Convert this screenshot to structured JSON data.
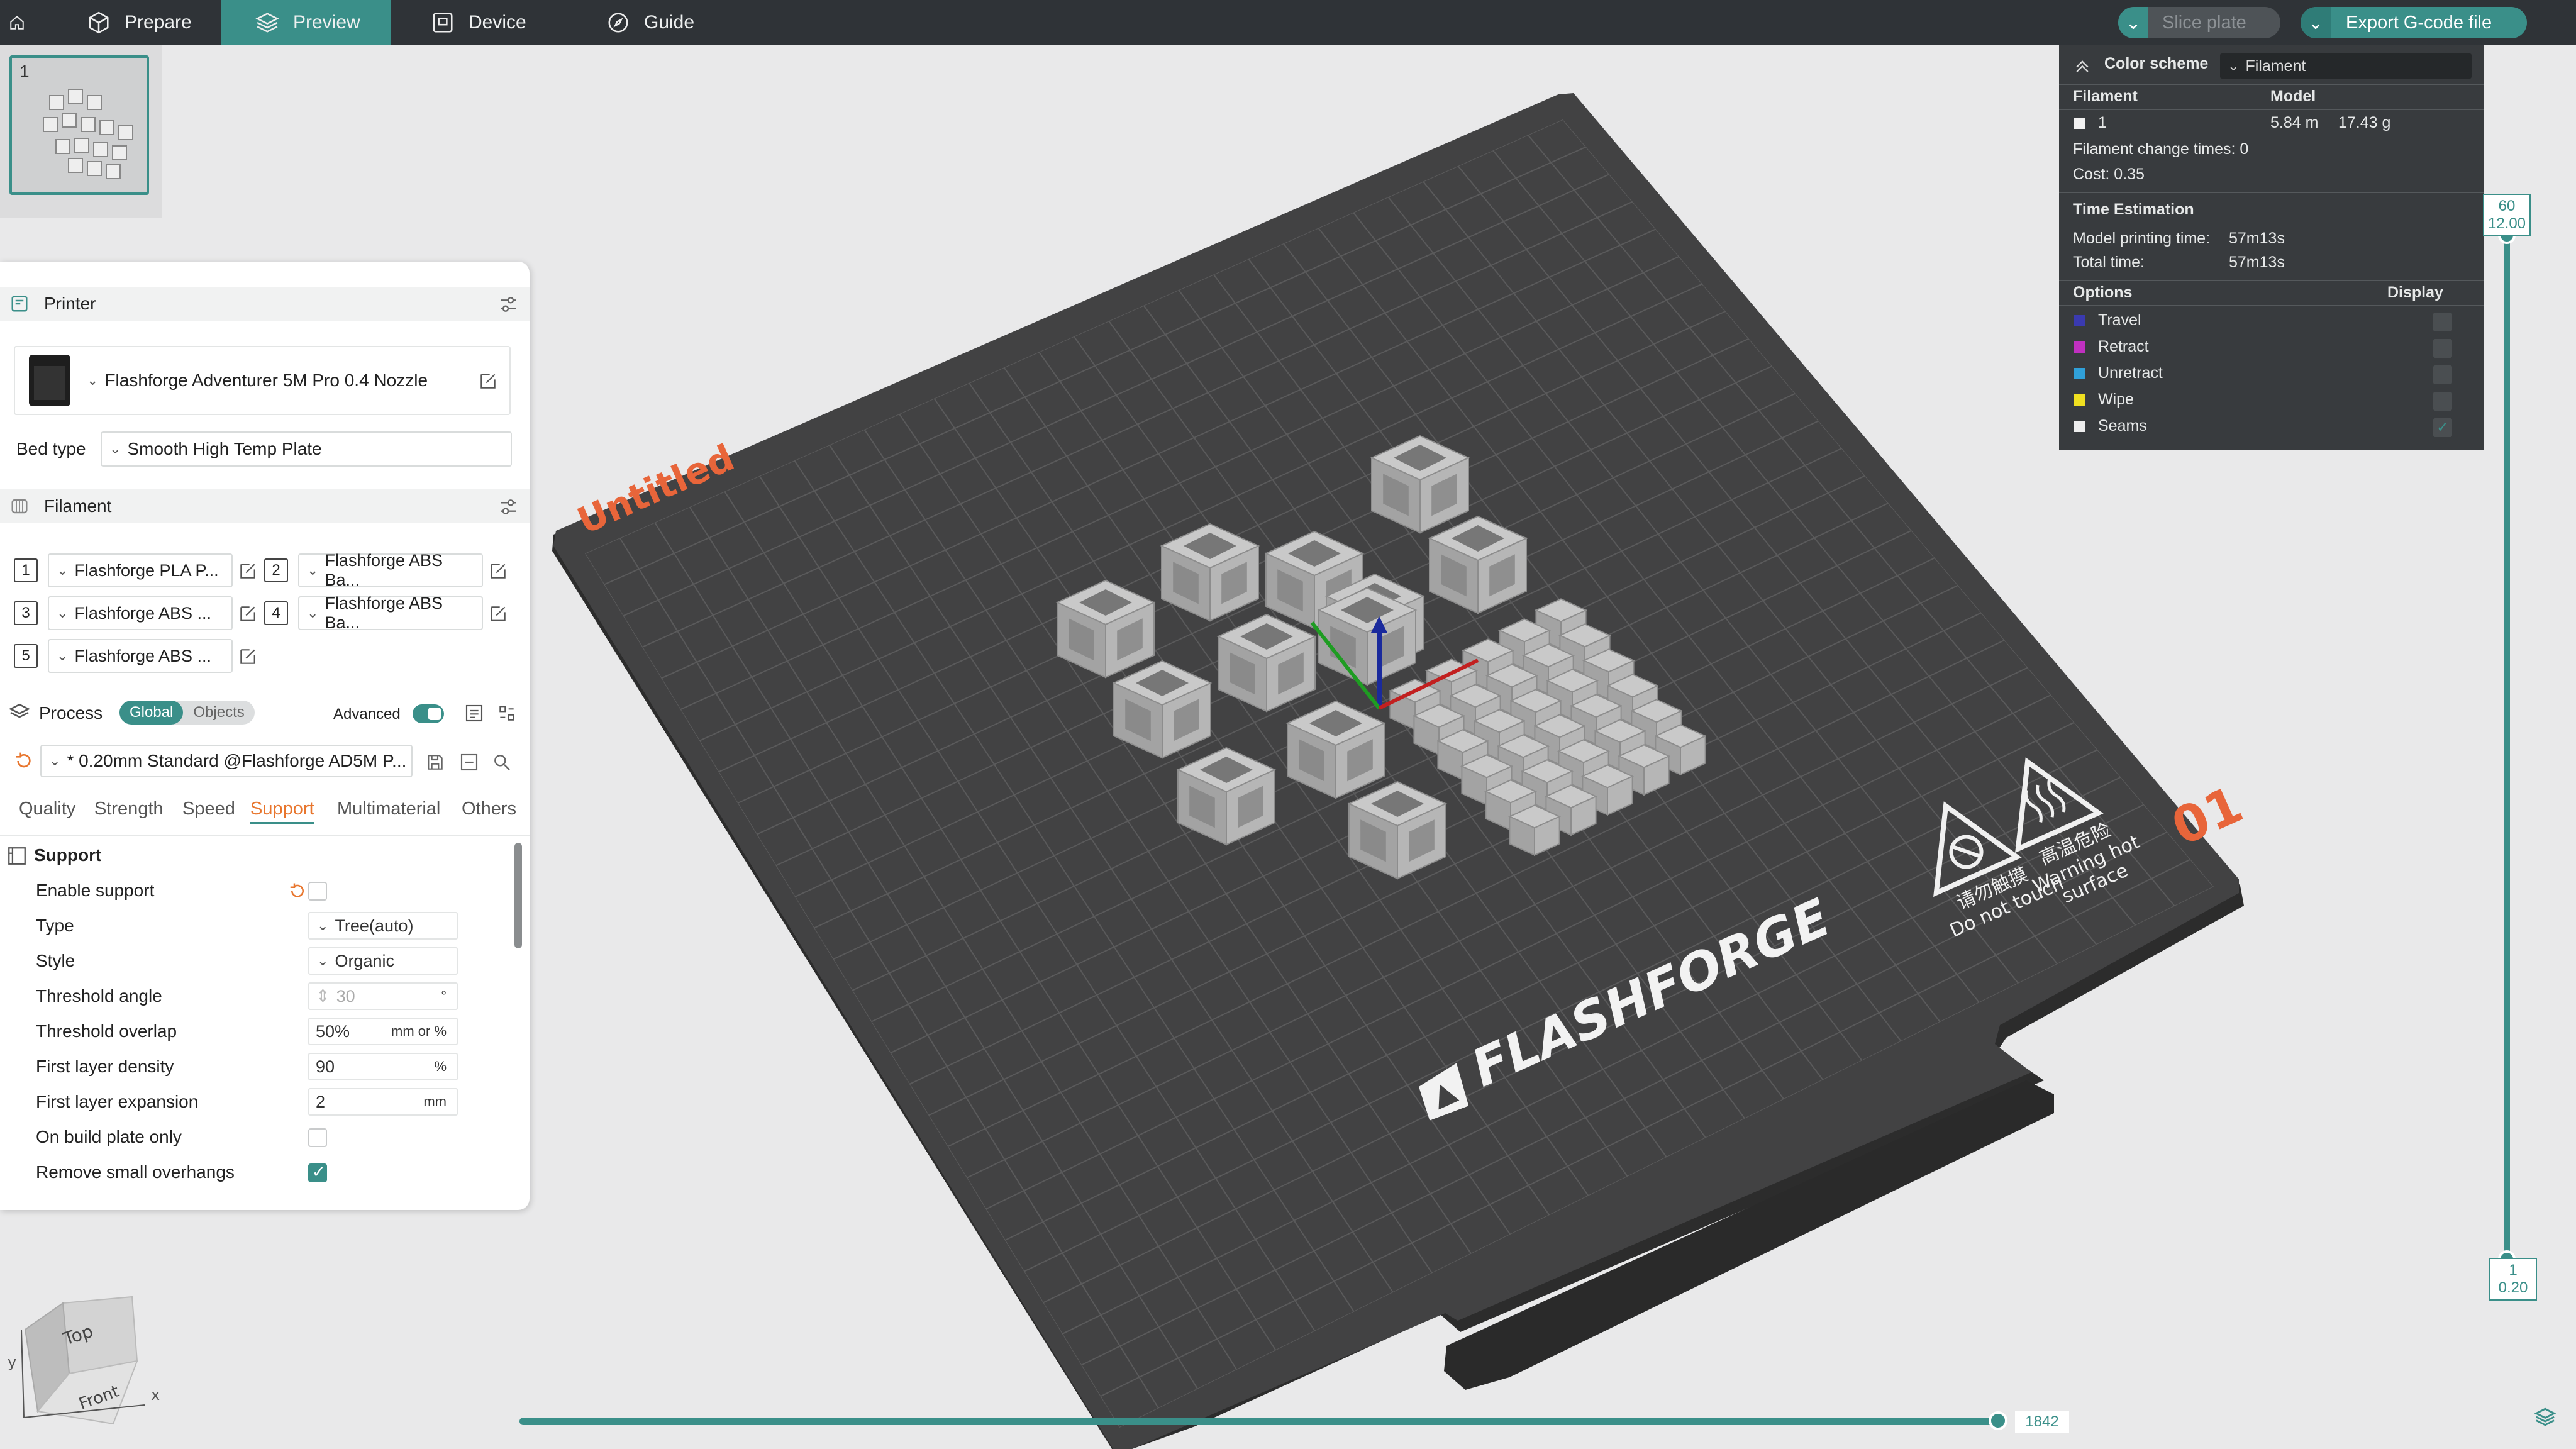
{
  "topbar": {
    "tabs": [
      "Prepare",
      "Preview",
      "Device",
      "Guide"
    ],
    "slice_label": "Slice plate",
    "export_label": "Export G-code file"
  },
  "plate": {
    "number": "1"
  },
  "printer": {
    "section_title": "Printer",
    "name": "Flashforge Adventurer 5M Pro 0.4 Nozzle",
    "bed_label": "Bed type",
    "bed_value": "Smooth High Temp Plate"
  },
  "filament": {
    "section_title": "Filament",
    "items": [
      {
        "idx": "1",
        "name": "Flashforge PLA P..."
      },
      {
        "idx": "2",
        "name": "Flashforge ABS Ba..."
      },
      {
        "idx": "3",
        "name": "Flashforge ABS ..."
      },
      {
        "idx": "4",
        "name": "Flashforge ABS Ba..."
      },
      {
        "idx": "5",
        "name": "Flashforge ABS ..."
      }
    ]
  },
  "process": {
    "section_title": "Process",
    "seg_global": "Global",
    "seg_objects": "Objects",
    "advanced_label": "Advanced",
    "preset": "* 0.20mm Standard @Flashforge AD5M P...",
    "subtabs": [
      "Quality",
      "Strength",
      "Speed",
      "Support",
      "Multimaterial",
      "Others"
    ],
    "group_title": "Support",
    "options": [
      {
        "label": "Enable support",
        "kind": "checkbox",
        "checked": false
      },
      {
        "label": "Type",
        "kind": "select",
        "value": "Tree(auto)"
      },
      {
        "label": "Style",
        "kind": "select",
        "value": "Organic"
      },
      {
        "label": "Threshold angle",
        "kind": "spin",
        "value": "30",
        "unit": "°"
      },
      {
        "label": "Threshold overlap",
        "kind": "text",
        "value": "50%",
        "unit": "mm or %"
      },
      {
        "label": "First layer density",
        "kind": "text",
        "value": "90",
        "unit": "%"
      },
      {
        "label": "First layer expansion",
        "kind": "text",
        "value": "2",
        "unit": "mm"
      },
      {
        "label": "On build plate only",
        "kind": "checkbox",
        "checked": false
      },
      {
        "label": "Remove small overhangs",
        "kind": "checkbox",
        "checked": true
      }
    ]
  },
  "legend": {
    "color_scheme_label": "Color scheme",
    "color_scheme_value": "Filament",
    "col_filament": "Filament",
    "col_model": "Model",
    "filament_idx": "1",
    "filament_length": "5.84 m",
    "filament_weight": "17.43 g",
    "change_times": "Filament change times:  0",
    "cost": "Cost:  0.35",
    "time_title": "Time Estimation",
    "model_time_label": "Model printing time:",
    "model_time": "57m13s",
    "total_time_label": "Total time:",
    "total_time": "57m13s",
    "options_label": "Options",
    "display_label": "Display",
    "options": [
      {
        "name": "Travel",
        "color": "#3a3ab0",
        "checked": false
      },
      {
        "name": "Retract",
        "color": "#c030c0",
        "checked": false
      },
      {
        "name": "Unretract",
        "color": "#30a0d8",
        "checked": false
      },
      {
        "name": "Wipe",
        "color": "#f0e020",
        "checked": false
      },
      {
        "name": "Seams",
        "color": "#eeeeee",
        "checked": true
      }
    ]
  },
  "layers": {
    "top_layer": "60",
    "top_height": "12.00",
    "bottom_layer": "1",
    "bottom_height": "0.20"
  },
  "moves": {
    "current": "1842"
  },
  "bed": {
    "plate_name": "Untitled",
    "plate_index": "01",
    "brand": "FLASHFORGE",
    "warn1_cn": "请勿触摸",
    "warn1_en": "Do not touch",
    "warn2_cn": "高温危险",
    "warn2_en": "Warning hot",
    "warn2_en2": "surface"
  },
  "cube_nav": {
    "top": "Top",
    "front": "Front",
    "x": "x",
    "y": "y"
  }
}
